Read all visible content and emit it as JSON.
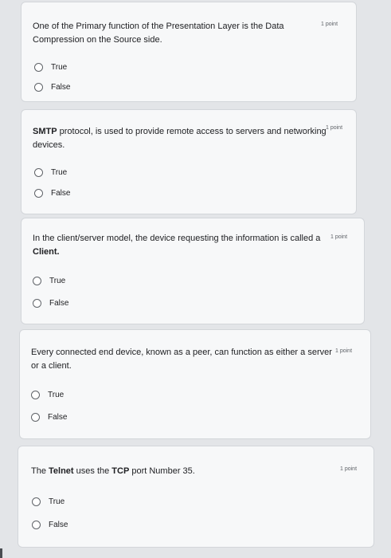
{
  "questions": [
    {
      "text_parts": [
        "One of the Primary function of the Presentation Layer is the Data",
        "Compression on the Source side."
      ],
      "points": "1 point",
      "options": [
        "True",
        "False"
      ]
    },
    {
      "bold_lead": "SMTP",
      "text_after_bold": " protocol, is used to provide remote access to servers and networking",
      "text_line2": "devices.",
      "points": "1 point",
      "options": [
        "True",
        "False"
      ]
    },
    {
      "text_line1": "In the client/server model, the device requesting the information is called a",
      "bold_line2": "Client.",
      "points": "1 point",
      "options": [
        "True",
        "False"
      ]
    },
    {
      "text_parts": [
        "Every connected end device, known as a peer, can function as either a server",
        "or a client."
      ],
      "points": "1 point",
      "options": [
        "True",
        "False"
      ]
    },
    {
      "seg1": "The ",
      "bold1": "Telnet",
      "seg2": " uses the ",
      "bold2": "TCP",
      "seg3": " port Number 35.",
      "points": "1 point",
      "options": [
        "True",
        "False"
      ]
    }
  ]
}
